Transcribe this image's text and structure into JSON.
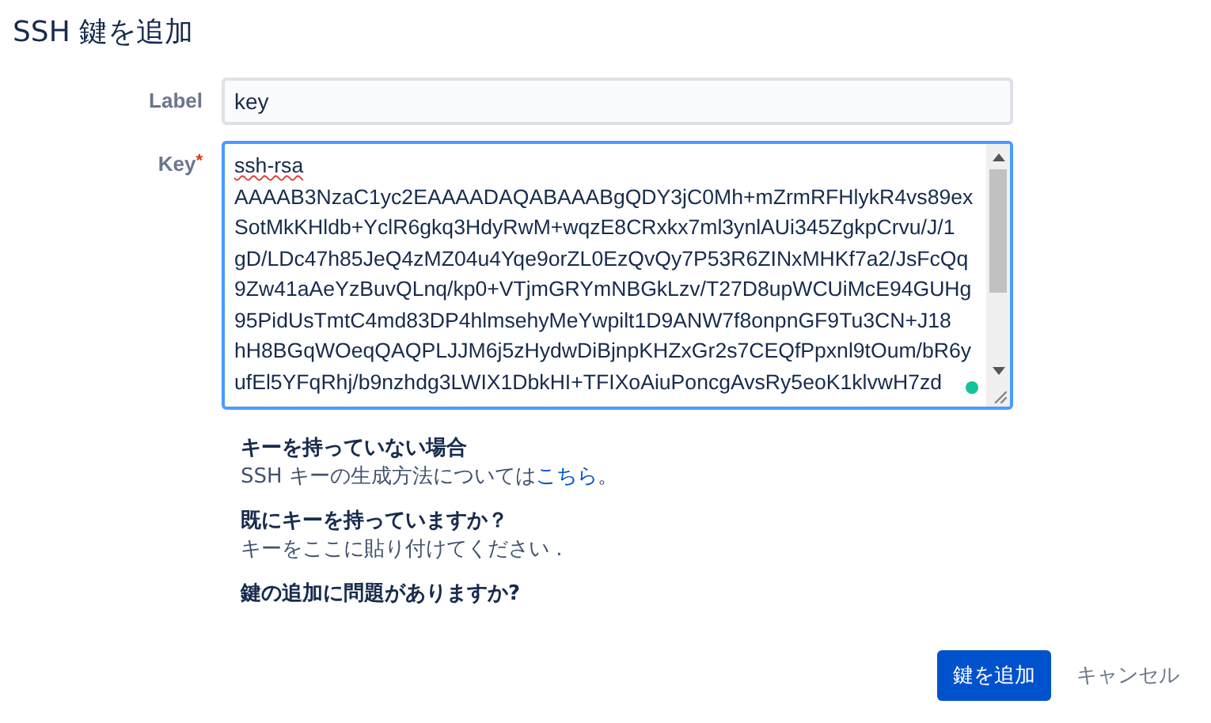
{
  "dialog": {
    "title": "SSH 鍵を追加"
  },
  "form": {
    "label_field": {
      "label": "Label",
      "value": "key"
    },
    "key_field": {
      "label": "Key",
      "required_mark": "*",
      "lines": [
        "ssh-rsa",
        "AAAAB3NzaC1yc2EAAAADAQABAAABgQDY3jC0Mh+mZrmRFHlykR4vs89ex",
        "SotMkKHldb+YclR6gkq3HdyRwM+wqzE8CRxkx7ml3ynlAUi345ZgkpCrvu/J/1",
        "gD/LDc47h85JeQ4zMZ04u4Yqe9orZL0EzQvQy7P53R6ZINxMHKf7a2/JsFcQq",
        "9Zw41aAeYzBuvQLnq/kp0+VTjmGRYmNBGkLzv/T27D8upWCUiMcE94GUHg",
        "95PidUsTmtC4md83DP4hlmsehyMeYwpilt1D9ANW7f8onpnGF9Tu3CN+J18",
        "hH8BGqWOeqQAQPLJJM6j5zHydwDiBjnpKHZxGr2s7CEQfPpxnl9tOum/bR6y",
        "ufEl5YFqRhj/b9nzhdg3LWIX1DbkHI+TFIXoAiuPoncgAvsRy5eoK1klvwH7zd"
      ]
    }
  },
  "help": [
    {
      "heading": "キーを持っていない場合",
      "text": "SSH キーの生成方法については",
      "link": "こちら",
      "after": "。"
    },
    {
      "heading": "既にキーを持っていますか？",
      "text": "キーをここに貼り付けてください ."
    },
    {
      "heading": "鍵の追加に問題がありますか?"
    }
  ],
  "footer": {
    "buttons": [
      {
        "label": "鍵を追加",
        "kind": "primary"
      },
      {
        "label": "キャンセル",
        "kind": "link"
      }
    ]
  }
}
